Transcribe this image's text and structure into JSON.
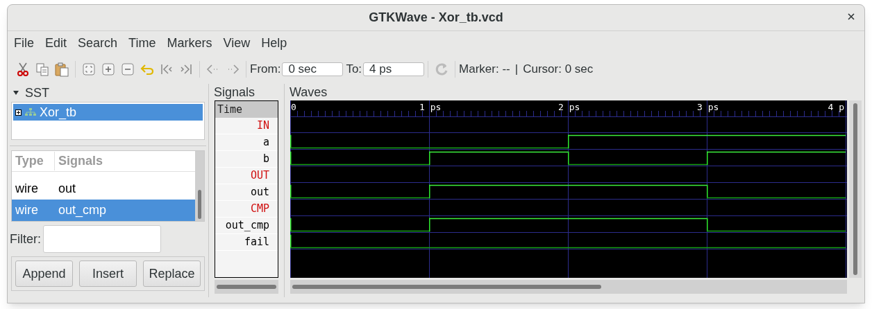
{
  "window": {
    "title": "GTKWave - Xor_tb.vcd"
  },
  "menu": [
    "File",
    "Edit",
    "Search",
    "Time",
    "Markers",
    "View",
    "Help"
  ],
  "toolbar": {
    "from_label": "From:",
    "from_value": "0 sec",
    "to_label": "To:",
    "to_value": "4 ps",
    "marker": "Marker: --",
    "separator": "|",
    "cursor": "Cursor: 0 sec"
  },
  "sst": {
    "title": "SST",
    "expanded": true,
    "tree": [
      {
        "label": "Xor_tb",
        "selected": true,
        "expanded": false
      }
    ]
  },
  "signal_list": {
    "columns": [
      "Type",
      "Signals"
    ],
    "rows": [
      {
        "type": "wire",
        "name": "out",
        "selected": false
      },
      {
        "type": "wire",
        "name": "out_cmp",
        "selected": true
      }
    ]
  },
  "filter": {
    "label": "Filter:"
  },
  "buttons": [
    "Append",
    "Insert",
    "Replace"
  ],
  "signals_panel": {
    "title": "Signals",
    "header": "Time",
    "rows": [
      {
        "kind": "group",
        "label": "IN"
      },
      {
        "kind": "signal",
        "label": "a",
        "high": [
          false,
          false,
          true,
          true
        ]
      },
      {
        "kind": "signal",
        "label": "b",
        "high": [
          false,
          true,
          false,
          true
        ]
      },
      {
        "kind": "group",
        "label": "OUT"
      },
      {
        "kind": "signal",
        "label": "out",
        "high": [
          false,
          true,
          true,
          false
        ]
      },
      {
        "kind": "group",
        "label": "CMP"
      },
      {
        "kind": "signal",
        "label": "out_cmp",
        "high": [
          false,
          true,
          true,
          false
        ]
      },
      {
        "kind": "signal",
        "label": "fail",
        "high": [
          false,
          false,
          false,
          false
        ]
      }
    ]
  },
  "waves_panel": {
    "title": "Waves",
    "ruler": [
      "0",
      "1 ps",
      "2 ps",
      "3 ps",
      "4 p"
    ]
  }
}
